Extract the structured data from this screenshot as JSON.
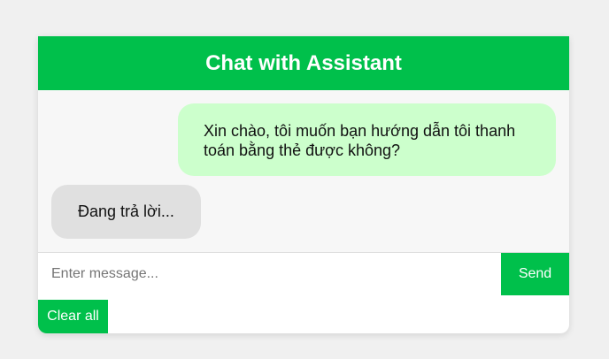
{
  "header": {
    "title": "Chat with Assistant"
  },
  "messages": [
    {
      "role": "user",
      "text": "Xin chào, tôi muốn bạn hướng dẫn tôi thanh toán bằng thẻ được không?"
    },
    {
      "role": "assistant",
      "text": "Đang trả lời..."
    }
  ],
  "composer": {
    "placeholder": "Enter message...",
    "value": "",
    "send_label": "Send",
    "clear_label": "Clear all"
  },
  "colors": {
    "accent": "#00c04b",
    "user_bubble": "#ccffcc",
    "assistant_bubble": "#e0e0e0",
    "page_background": "#f0f0f0"
  }
}
